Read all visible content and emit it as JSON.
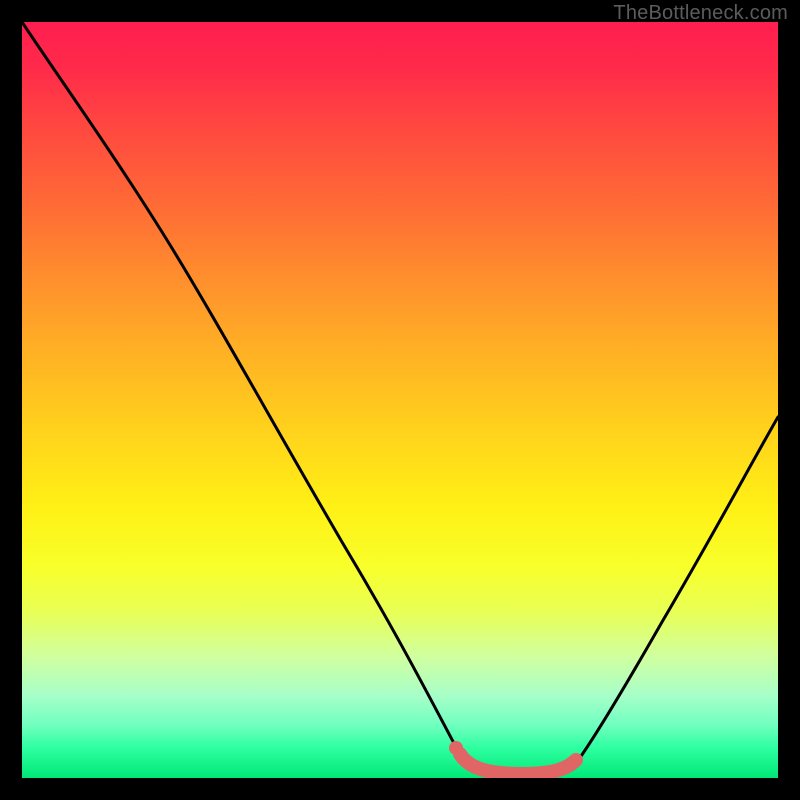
{
  "watermark": "TheBottleneck.com",
  "colors": {
    "frame": "#000000",
    "curve": "#000000",
    "highlight_stroke": "#e06666",
    "highlight_fill": "#e06666",
    "gradient_top": "#ff1e50",
    "gradient_bottom": "#00e878"
  },
  "chart_data": {
    "type": "line",
    "title": "",
    "xlabel": "",
    "ylabel": "",
    "xlim": [
      0,
      100
    ],
    "ylim": [
      0,
      100
    ],
    "grid": false,
    "legend": false,
    "series": [
      {
        "name": "curve-left",
        "x": [
          0,
          4,
          8,
          12,
          16,
          20,
          24,
          28,
          32,
          36,
          40,
          44,
          48,
          52,
          55,
          57,
          58.5
        ],
        "y": [
          100,
          95,
          90,
          85,
          79,
          73,
          66,
          59,
          52,
          45,
          37,
          29,
          21,
          13,
          6,
          2,
          0.5
        ]
      },
      {
        "name": "curve-right",
        "x": [
          73,
          75,
          78,
          81,
          84,
          87,
          90,
          93,
          96,
          99,
          100
        ],
        "y": [
          0.5,
          2,
          6,
          11,
          17,
          24,
          31,
          38,
          45,
          52,
          54
        ]
      },
      {
        "name": "valley-floor",
        "x": [
          58.5,
          60,
          62,
          64,
          66,
          68,
          70,
          72,
          73
        ],
        "y": [
          0.5,
          0.2,
          0.1,
          0.1,
          0.1,
          0.1,
          0.2,
          0.3,
          0.5
        ]
      }
    ],
    "highlight": {
      "name": "optimal-range",
      "x": [
        57,
        73
      ],
      "y_approx": 1.5,
      "marker_left": {
        "x": 57.5,
        "y": 2.5
      }
    }
  }
}
